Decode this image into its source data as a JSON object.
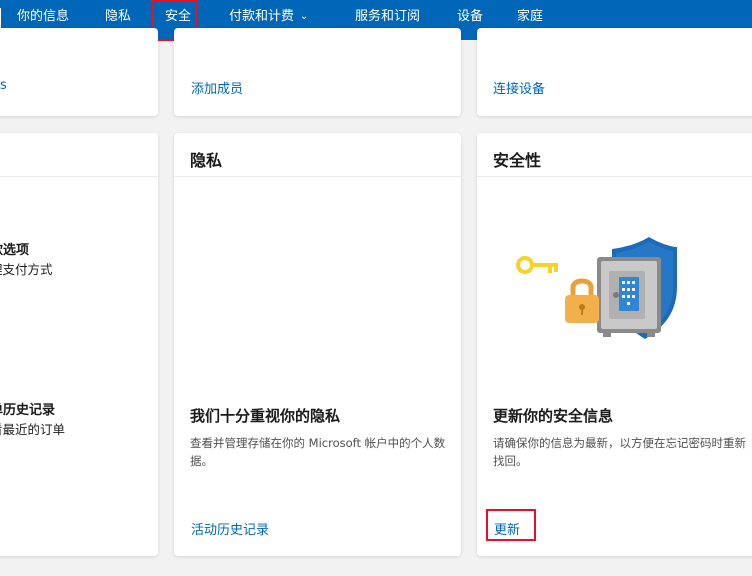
{
  "nav": {
    "items": [
      {
        "label": "你的信息"
      },
      {
        "label": "隐私"
      },
      {
        "label": "安全"
      },
      {
        "label": "付款和计费"
      },
      {
        "label": "服务和订阅"
      },
      {
        "label": "设备"
      },
      {
        "label": "家庭"
      }
    ]
  },
  "top_cards": {
    "left_link": "s",
    "middle_link": "添加成员",
    "right_link": "连接设备"
  },
  "payment_card": {
    "option1_title": "款选项",
    "option1_sub": "理支付方式",
    "option2_title": "单历史记录",
    "option2_sub": "看最近的订单"
  },
  "privacy_card": {
    "title": "隐私",
    "heading": "我们十分重视你的隐私",
    "description": "查看并管理存储在你的 Microsoft 帐户中的个人数据。",
    "link": "活动历史记录"
  },
  "security_card": {
    "title": "安全性",
    "heading": "更新你的安全信息",
    "description": "请确保你的信息为最新，以方便在忘记密码时重新找回。",
    "link": "更新",
    "illustration": "security-key-safe-shield-illustration"
  },
  "colors": {
    "nav_bg": "#0067b8",
    "link": "#0067b8",
    "highlight": "#e81123"
  }
}
